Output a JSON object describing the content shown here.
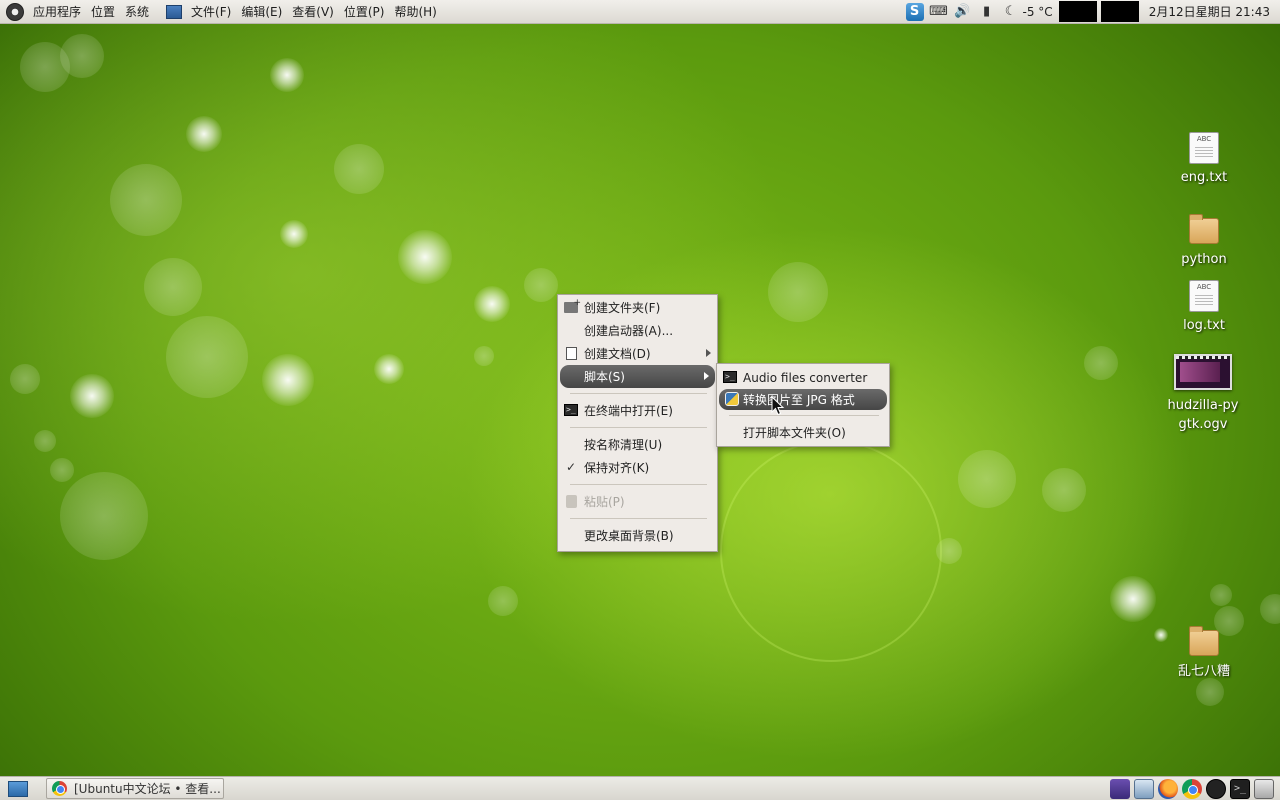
{
  "top_panel": {
    "main_menu": [
      "应用程序",
      "位置",
      "系统"
    ],
    "app_menu": [
      "文件(F)",
      "编辑(E)",
      "查看(V)",
      "位置(P)",
      "帮助(H)"
    ],
    "weather": "-5 °C",
    "clock": "2月12日星期日 21:43"
  },
  "desktop_icons": [
    {
      "name": "eng.txt",
      "type": "text",
      "badge": "ABC"
    },
    {
      "name": "python",
      "type": "folder"
    },
    {
      "name": "log.txt",
      "type": "text",
      "badge": "ABC"
    },
    {
      "name": "hudzilla-pygtk.ogv",
      "type": "video"
    },
    {
      "name": "乱七八糟",
      "type": "folder"
    }
  ],
  "context_menu": {
    "items": [
      {
        "label": "创建文件夹(F)",
        "icon": "new-folder-icon"
      },
      {
        "label": "创建启动器(A)..."
      },
      {
        "label": "创建文档(D)",
        "icon": "document-icon",
        "submenu": true
      },
      {
        "label": "脚本(S)",
        "submenu": true,
        "selected": true
      },
      {
        "label": "在终端中打开(E)",
        "icon": "terminal-icon"
      },
      {
        "label": "按名称清理(U)"
      },
      {
        "label": "保持对齐(K)",
        "checked": true
      },
      {
        "label": "粘贴(P)",
        "icon": "paste-icon",
        "disabled": true
      },
      {
        "label": "更改桌面背景(B)"
      }
    ]
  },
  "scripts_submenu": {
    "items": [
      {
        "label": "Audio files converter",
        "icon": "terminal-icon"
      },
      {
        "label": "转换图片至 JPG 格式",
        "icon": "python-icon",
        "selected": true
      },
      {
        "label": "打开脚本文件夹(O)"
      }
    ]
  },
  "taskbar": {
    "window_title": "[Ubuntu中文论坛 • 查看..."
  },
  "colors": {
    "menu_bg": "#efebe7",
    "menu_selected": "#555555",
    "wallpaper": "#6aab14"
  }
}
